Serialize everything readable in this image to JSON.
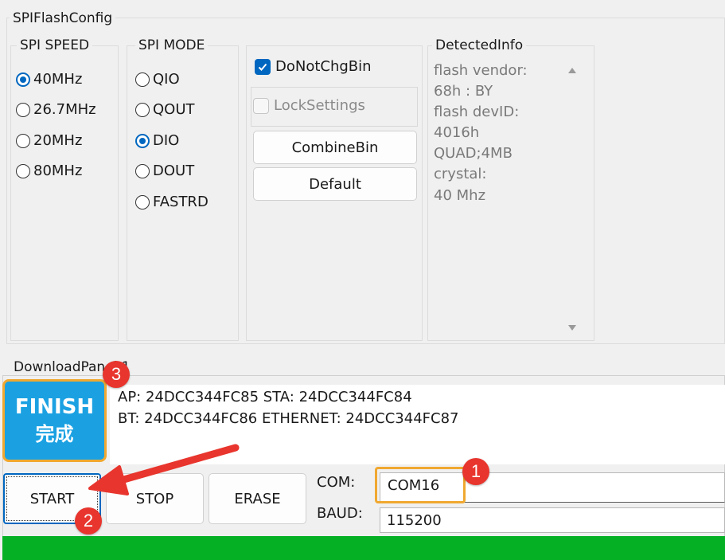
{
  "window": {
    "title": "SPIFlashConfig"
  },
  "spi_speed": {
    "title": "SPI SPEED",
    "options": [
      {
        "label": "40MHz",
        "selected": true
      },
      {
        "label": "26.7MHz",
        "selected": false
      },
      {
        "label": "20MHz",
        "selected": false
      },
      {
        "label": "80MHz",
        "selected": false
      }
    ]
  },
  "spi_mode": {
    "title": "SPI MODE",
    "options": [
      {
        "label": "QIO",
        "selected": false
      },
      {
        "label": "QOUT",
        "selected": false
      },
      {
        "label": "DIO",
        "selected": true
      },
      {
        "label": "DOUT",
        "selected": false
      },
      {
        "label": "FASTRD",
        "selected": false
      }
    ]
  },
  "options": {
    "do_not_chg_bin": {
      "label": "DoNotChgBin",
      "checked": true
    },
    "lock_settings": {
      "label": "LockSettings",
      "checked": false
    },
    "combine_bin_label": "CombineBin",
    "default_label": "Default"
  },
  "detected_info": {
    "title": "DetectedInfo",
    "lines": [
      "flash vendor:",
      "68h : BY",
      "flash devID:",
      "4016h",
      "QUAD;4MB",
      "crystal:",
      "40 Mhz"
    ]
  },
  "download_panel": {
    "title": "DownloadPanel 1",
    "status": {
      "label_en": "FINISH",
      "label_zh": "完成",
      "color": "#1ba1e2"
    },
    "log_lines": [
      "AP:  24DCC344FC85  STA:  24DCC344FC84",
      "BT:  24DCC344FC86  ETHERNET:  24DCC344FC87"
    ],
    "start_label": "START",
    "stop_label": "STOP",
    "erase_label": "ERASE",
    "com_label": "COM:",
    "com_value": "COM16",
    "baud_label": "BAUD:",
    "baud_value": "115200",
    "progress": 1.0,
    "progress_color": "#06b025"
  },
  "annotations": {
    "badge_1": "1",
    "badge_2": "2",
    "badge_3": "3",
    "accent_color": "#f0a830",
    "badge_color": "#e8352d"
  }
}
